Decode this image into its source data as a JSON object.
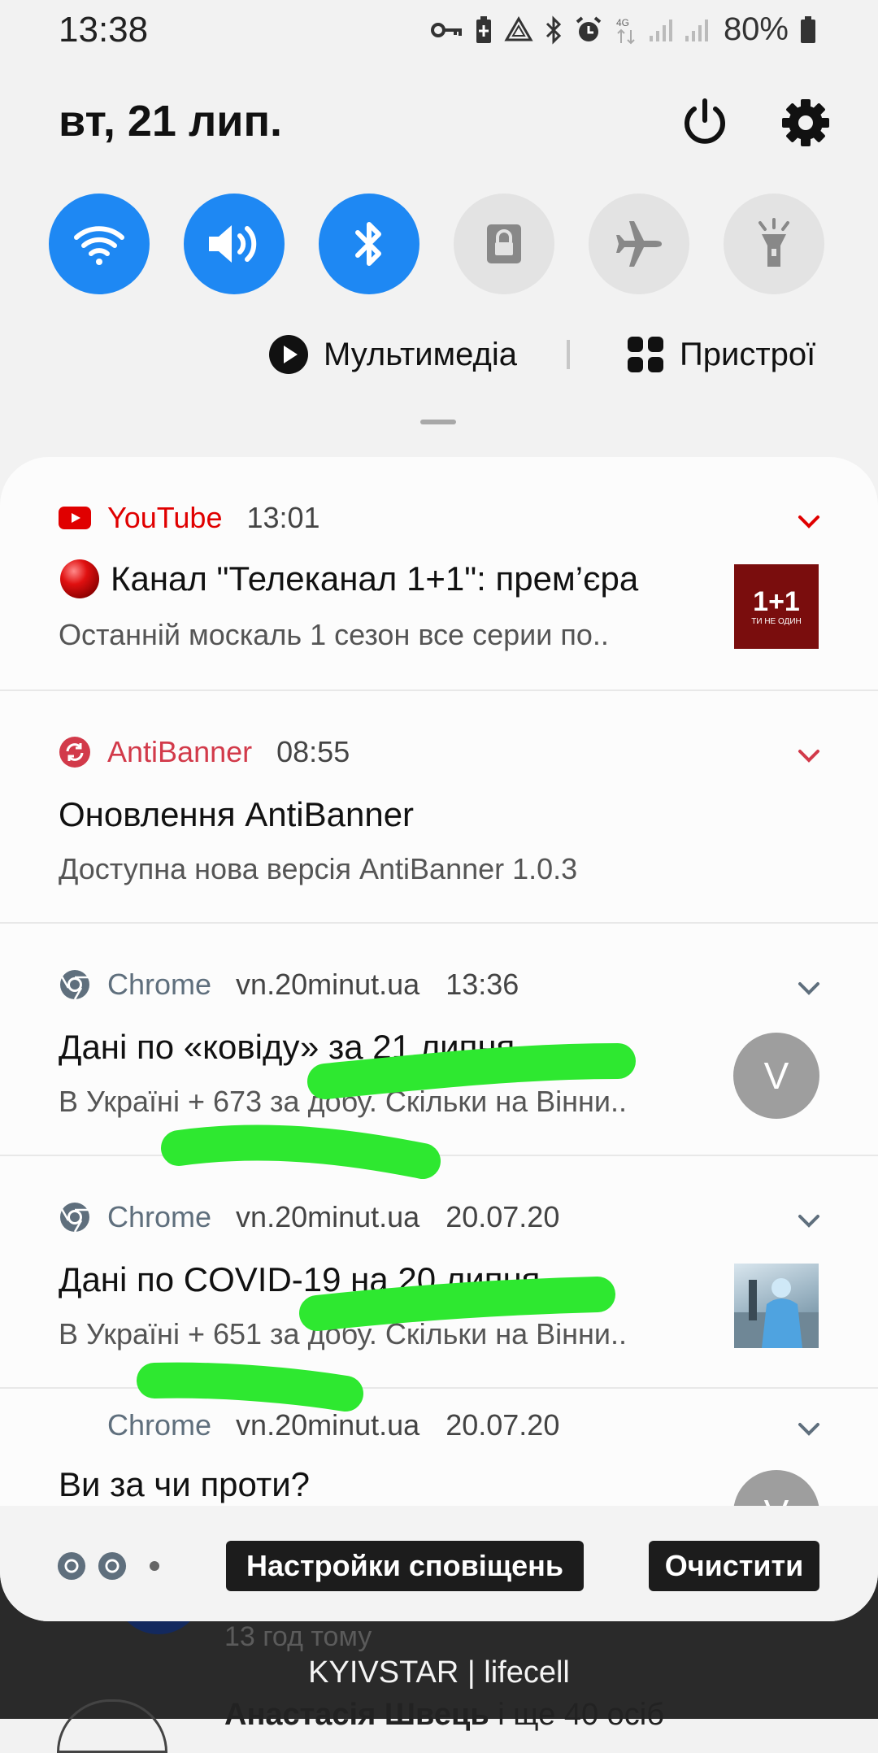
{
  "status_bar": {
    "time": "13:38",
    "battery": "80%",
    "network": "4G"
  },
  "header": {
    "date": "вт, 21 лип."
  },
  "quick_toggles": [
    {
      "name": "wifi",
      "on": true
    },
    {
      "name": "sound",
      "on": true
    },
    {
      "name": "bluetooth",
      "on": true
    },
    {
      "name": "screen-lock",
      "on": false
    },
    {
      "name": "airplane",
      "on": false
    },
    {
      "name": "flashlight",
      "on": false
    }
  ],
  "media_row": {
    "media_label": "Мультимедіа",
    "devices_label": "Пристрої"
  },
  "notifications": [
    {
      "app": "YouTube",
      "time": "13:01",
      "title": "Канал \"Телеканал 1+1\": прем’єра",
      "text": "Останній москаль 1 сезон все серии по..",
      "thumb_title": "1+1",
      "thumb_subtitle": "ТИ НЕ ОДИН"
    },
    {
      "app": "AntiBanner",
      "time": "08:55",
      "title": "Оновлення AntiBanner",
      "text": "Доступна нова версія AntiBanner 1.0.3"
    },
    {
      "app": "Chrome",
      "host": "vn.20minut.ua",
      "time": "13:36",
      "title": "Дані по «ковіду» за 21 липня",
      "text": "В Україні + 673 за добу. Скільки на Вінни..",
      "avatar": "V"
    },
    {
      "app": "Chrome",
      "host": "vn.20minut.ua",
      "time": "20.07.20",
      "title": "Дані по COVID-19 на 20 липня",
      "text": "В Україні + 651 за добу. Скільки на Вінни.."
    },
    {
      "app": "Chrome",
      "host": "vn.20minut.ua",
      "time": "20.07.20",
      "title": "Ви за чи проти?",
      "avatar": "V"
    }
  ],
  "actions": {
    "settings_label": "Настройки сповіщень",
    "clear_label": "Очистити"
  },
  "background": {
    "time_ago": "13 год тому",
    "name": "Анастасія Швець",
    "name_suffix": " і ще 40 осіб",
    "carrier": "KYIVSTAR | lifecell"
  },
  "colors": {
    "toggle_on": "#1e88f3",
    "youtube": "#e00000",
    "antibanner": "#d23a4a",
    "chrome": "#5f6f7d",
    "scribble": "#2ee830"
  }
}
